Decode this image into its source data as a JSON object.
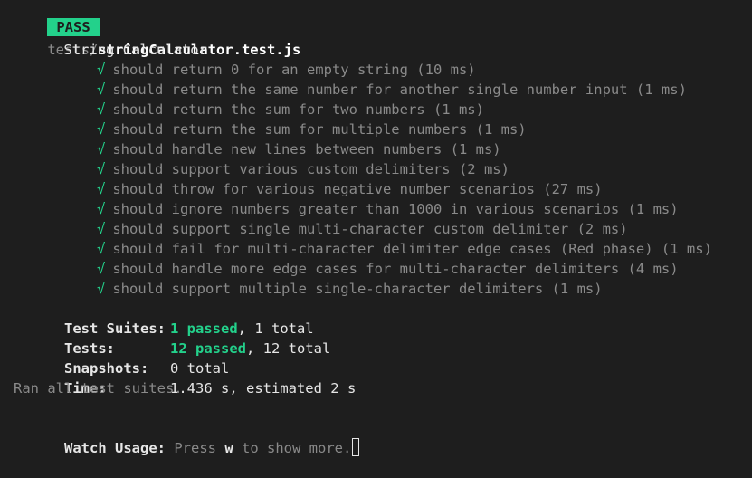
{
  "run_header": {
    "status": "PASS",
    "path_prefix": "tests/",
    "file_name": "stringCalculator.test.js"
  },
  "suite": {
    "name": "String Calculator",
    "tests": [
      {
        "label": "should return 0 for an empty string (10 ms)",
        "icon": "check-icon"
      },
      {
        "label": "should return the same number for another single number input (1 ms)",
        "icon": "check-icon"
      },
      {
        "label": "should return the sum for two numbers (1 ms)",
        "icon": "check-icon"
      },
      {
        "label": "should return the sum for multiple numbers (1 ms)",
        "icon": "check-icon"
      },
      {
        "label": "should handle new lines between numbers (1 ms)",
        "icon": "check-icon"
      },
      {
        "label": "should support various custom delimiters (2 ms)",
        "icon": "check-icon"
      },
      {
        "label": "should throw for various negative number scenarios (27 ms)",
        "icon": "check-icon"
      },
      {
        "label": "should ignore numbers greater than 1000 in various scenarios (1 ms)",
        "icon": "check-icon"
      },
      {
        "label": "should support single multi-character custom delimiter (2 ms)",
        "icon": "check-icon"
      },
      {
        "label": "should fail for multi-character delimiter edge cases (Red phase) (1 ms)",
        "icon": "check-icon"
      },
      {
        "label": "should handle more edge cases for multi-character delimiters (4 ms)",
        "icon": "check-icon"
      },
      {
        "label": "should support multiple single-character delimiters (1 ms)",
        "icon": "check-icon"
      }
    ]
  },
  "summary": {
    "test_suites_label": "Test Suites:",
    "test_suites_passed": "1 passed",
    "test_suites_rest": ", 1 total",
    "tests_label": "Tests:",
    "tests_passed": "12 passed",
    "tests_rest": ", 12 total",
    "snapshots_label": "Snapshots:",
    "snapshots_value": "0 total",
    "time_label": "Time:",
    "time_value": "1.436 s, estimated 2 s",
    "ran_all": "Ran all test suites."
  },
  "watch": {
    "label": "Watch Usage:",
    "press": "Press ",
    "key": "w",
    "rest": " to show more."
  },
  "colors": {
    "background": "#1e1e1e",
    "pass_green": "#23d18b",
    "text": "#cccccc",
    "dim": "#8a8a8a"
  }
}
